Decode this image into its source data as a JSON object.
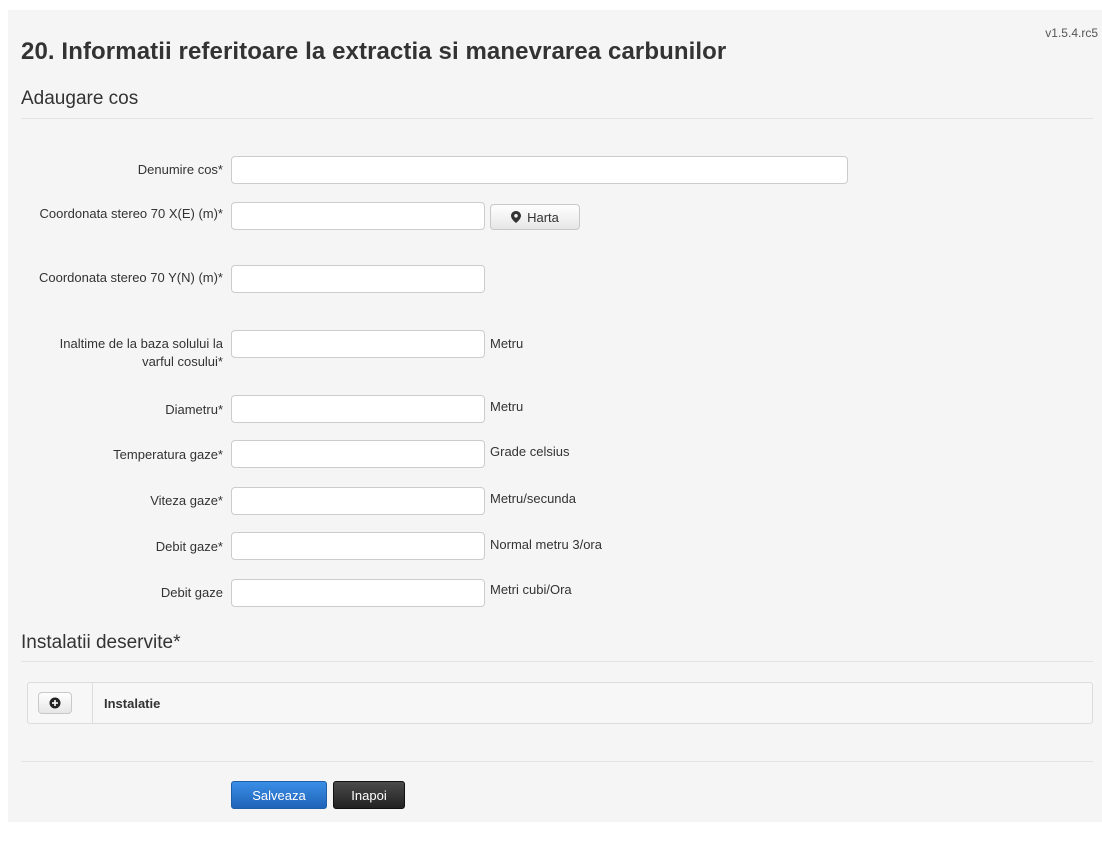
{
  "version": "v1.5.4.rc5",
  "page_title": "20. Informatii referitoare la extractia si manevrarea carbunilor",
  "section_add": "Adaugare cos",
  "fields": {
    "denumire": {
      "label": "Denumire cos*",
      "value": ""
    },
    "coord_x": {
      "label": "Coordonata stereo 70 X(E) (m)*",
      "value": ""
    },
    "harta_button": "Harta",
    "coord_y": {
      "label": "Coordonata stereo 70 Y(N) (m)*",
      "value": ""
    },
    "inaltime": {
      "label": "Inaltime de la baza solului la varful cosului*",
      "value": "",
      "unit": "Metru"
    },
    "diametru": {
      "label": "Diametru*",
      "value": "",
      "unit": "Metru"
    },
    "temperatura": {
      "label": "Temperatura gaze*",
      "value": "",
      "unit": "Grade celsius"
    },
    "viteza": {
      "label": "Viteza gaze*",
      "value": "",
      "unit": "Metru/secunda"
    },
    "debit_normal": {
      "label": "Debit gaze*",
      "value": "",
      "unit": "Normal metru 3/ora"
    },
    "debit_cubi": {
      "label": "Debit gaze",
      "value": "",
      "unit": "Metri cubi/Ora"
    }
  },
  "section_instalatii": "Instalatii deservite*",
  "instalatii_table": {
    "column_header": "Instalatie",
    "add_icon": "plus-circle-icon"
  },
  "actions": {
    "save_label": "Salveaza",
    "back_label": "Inapoi"
  },
  "colors": {
    "primary": "#2a7ad6",
    "dark_button": "#333333",
    "panel_bg": "#f5f5f5"
  }
}
